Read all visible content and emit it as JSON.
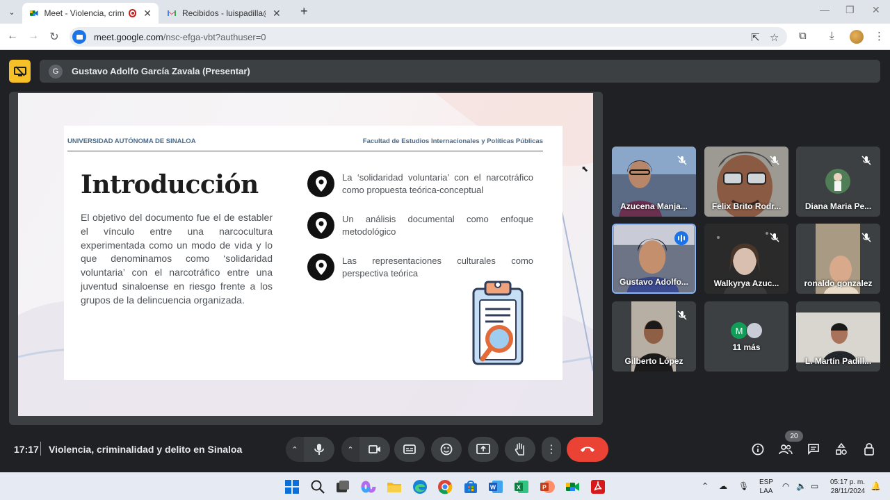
{
  "browser": {
    "tabs": [
      {
        "title": "Meet - Violencia, criminalid"
      },
      {
        "title": "Recibidos - luispadilla@uas.edu"
      }
    ],
    "url_host": "meet.google.com",
    "url_path": "/nsc-efga-vbt?authuser=0"
  },
  "meet": {
    "presenter_initial": "G",
    "presenter_label": "Gustavo Adolfo García Zavala (Presentar)",
    "meeting_time": "17:17",
    "meeting_title": "Violencia, criminalidad y delito en Sinaloa",
    "participants_count": "20",
    "more_participants_initial": "M",
    "more_participants_label": "11 más",
    "participants": [
      {
        "name": "Azucena Manja...",
        "muted": true
      },
      {
        "name": "Felix Brito Rodr...",
        "muted": true
      },
      {
        "name": "Diana Maria Pe...",
        "muted": true
      },
      {
        "name": "Gustavo Adolfo...",
        "muted": false,
        "speaking": true
      },
      {
        "name": "Walkyrya Azuc...",
        "muted": true
      },
      {
        "name": "ronaldo gonzalez",
        "muted": true
      },
      {
        "name": "Gilberto López",
        "muted": true
      },
      {
        "name": "L. Martín Padill...",
        "muted": false
      }
    ]
  },
  "slide": {
    "university": "UNIVERSIDAD AUTÓNOMA DE SINALOA",
    "faculty": "Facultad de Estudios Internacionales y Políticas Públicas",
    "title": "Introducción",
    "body": "El objetivo del documento fue el de establer el vínculo entre una narcocultura experimentada como un modo de vida y lo que denominamos como ‘solidaridad voluntaria’ con el narcotráfico entre una juventud sinaloense en riesgo frente a los grupos de la delincuencia organizada.",
    "bullets": [
      "La ‘solidaridad voluntaria’ con el narcotráfico como propuesta teórica-conceptual",
      "Un análisis documental como enfoque metodológico",
      "Las representaciones culturales como perspectiva teórica"
    ]
  },
  "taskbar": {
    "lang_top": "ESP",
    "lang_bottom": "LAA",
    "time": "05:17 p. m.",
    "date": "28/11/2024"
  }
}
